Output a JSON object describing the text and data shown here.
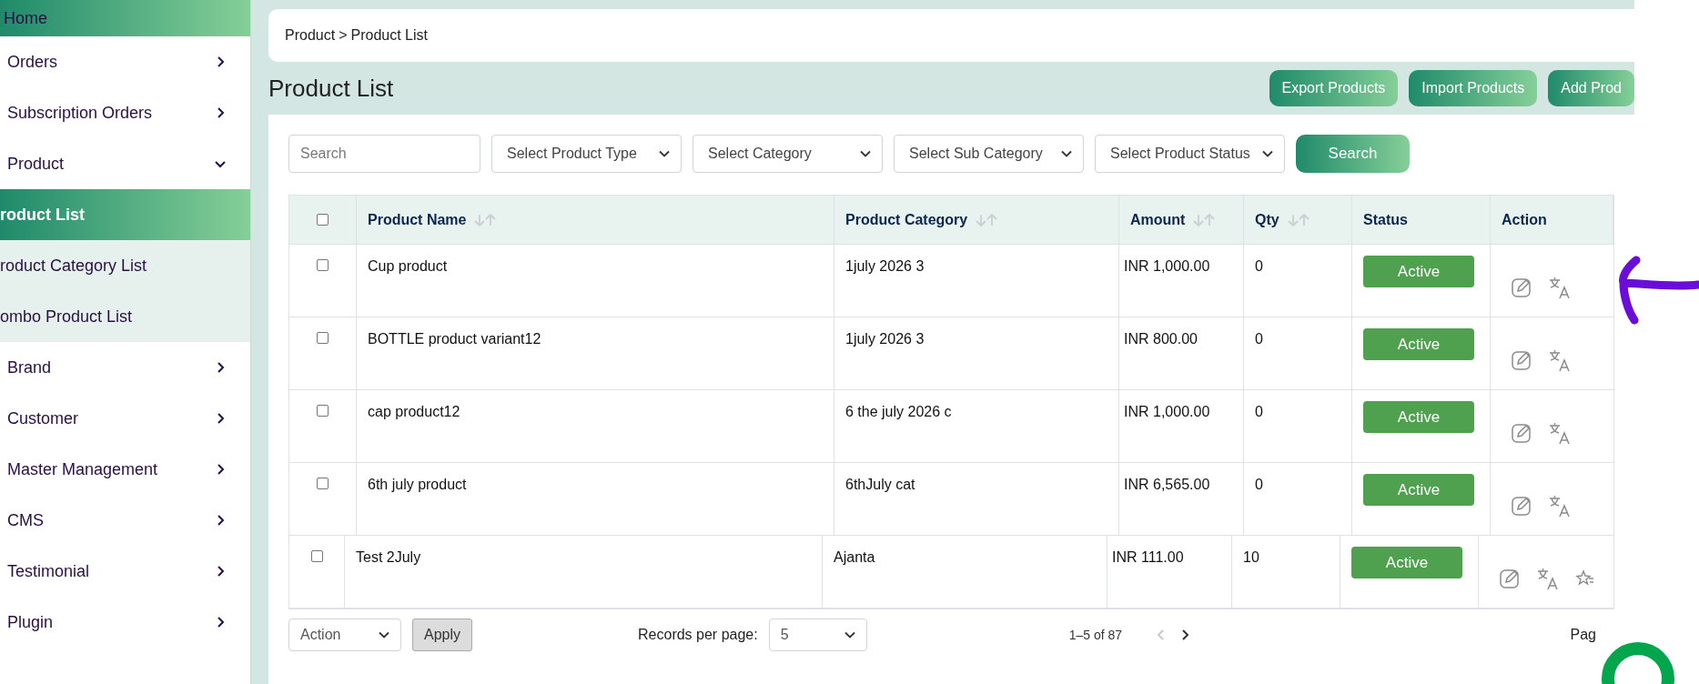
{
  "sidebar": {
    "items": [
      {
        "kind": "link",
        "label": "Home",
        "selected": true
      },
      {
        "kind": "group",
        "label": "Orders",
        "expanded": false
      },
      {
        "kind": "group",
        "label": "Subscription Orders",
        "expanded": false
      },
      {
        "kind": "group",
        "label": "Product",
        "expanded": true,
        "children": [
          {
            "label": "roduct List",
            "selected": true
          },
          {
            "label": "roduct Category List",
            "selected": false
          },
          {
            "label": "ombo Product List",
            "selected": false
          }
        ]
      },
      {
        "kind": "group",
        "label": "Brand",
        "expanded": false
      },
      {
        "kind": "group",
        "label": "Customer",
        "expanded": false
      },
      {
        "kind": "group",
        "label": "Master Management",
        "expanded": false
      },
      {
        "kind": "group",
        "label": "CMS",
        "expanded": false
      },
      {
        "kind": "group",
        "label": "Testimonial",
        "expanded": false
      },
      {
        "kind": "group",
        "label": "Plugin",
        "expanded": false
      }
    ]
  },
  "breadcrumb": {
    "items": [
      "Product",
      "Product List"
    ],
    "separator": ">"
  },
  "page_title": "Product List",
  "header_buttons": [
    "Export Products",
    "Import Products",
    "Add Prod"
  ],
  "filters": {
    "search": {
      "placeholder": "Search"
    },
    "selects": [
      "Select Product Type",
      "Select Category",
      "Select Sub Category",
      "Select Product Status"
    ],
    "button": "Search"
  },
  "table": {
    "select_all": {
      "checked": false
    },
    "columns": [
      {
        "label": "Product Name",
        "sortable": true
      },
      {
        "label": "Product Category",
        "sortable": true
      },
      {
        "label": "Amount",
        "sortable": true
      },
      {
        "label": "Qty",
        "sortable": true
      },
      {
        "label": "Status",
        "sortable": false
      },
      {
        "label": "Action",
        "sortable": false
      }
    ],
    "rows": [
      {
        "checked": false,
        "name": "Cup product",
        "category": "1july 2026 3",
        "amount": "INR 1,000.00",
        "qty": "0",
        "status": "Active",
        "actions": [
          {
            "kind": "edit"
          },
          {
            "kind": "translate"
          }
        ]
      },
      {
        "checked": false,
        "name": "BOTTLE product variant12",
        "category": "1july 2026 3",
        "amount": "INR 800.00",
        "qty": "0",
        "status": "Active",
        "actions": [
          {
            "kind": "edit"
          },
          {
            "kind": "translate"
          }
        ]
      },
      {
        "checked": false,
        "name": "cap product12",
        "category": "6 the july 2026 c",
        "amount": "INR 1,000.00",
        "qty": "0",
        "status": "Active",
        "actions": [
          {
            "kind": "edit"
          },
          {
            "kind": "translate"
          }
        ]
      },
      {
        "checked": false,
        "name": "6th july product",
        "category": "6thJuly cat",
        "amount": "INR 6,565.00",
        "qty": "0",
        "status": "Active",
        "actions": [
          {
            "kind": "edit"
          },
          {
            "kind": "translate"
          }
        ]
      },
      {
        "checked": false,
        "name": "Test 2July",
        "category": "Ajanta",
        "amount": "INR 111.00",
        "qty": "10",
        "status": "Active",
        "actions": [
          {
            "kind": "edit"
          },
          {
            "kind": "translate"
          },
          {
            "kind": "rate"
          }
        ]
      }
    ]
  },
  "footer": {
    "bulk_action": "Action",
    "apply": "Apply",
    "records_label": "Records per page:",
    "records_value": "5",
    "range": "1–5 of 87",
    "prev_disabled": true,
    "page_label": "Pag"
  }
}
